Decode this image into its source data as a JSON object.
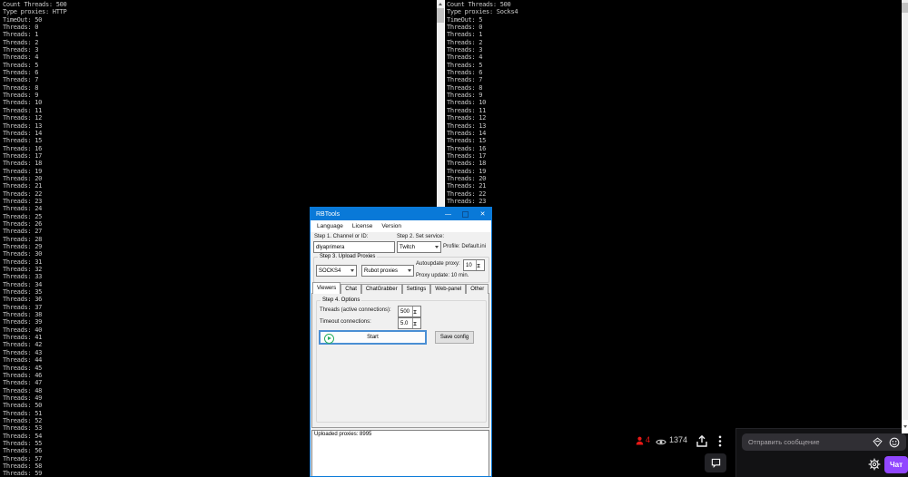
{
  "colors": {
    "accent_blue": "#0979d8",
    "twitch_purple": "#9147ff",
    "live_red": "#e91916",
    "start_green": "#27ae60"
  },
  "left_console": {
    "lines": [
      "Count Threads: 500",
      "Type proxies: HTTP",
      "TimeOut: 50",
      "Threads: 0",
      "Threads: 1",
      "Threads: 2",
      "Threads: 3",
      "Threads: 4",
      "Threads: 5",
      "Threads: 6",
      "Threads: 7",
      "Threads: 8",
      "Threads: 9",
      "Threads: 10",
      "Threads: 11",
      "Threads: 12",
      "Threads: 13",
      "Threads: 14",
      "Threads: 15",
      "Threads: 16",
      "Threads: 17",
      "Threads: 18",
      "Threads: 19",
      "Threads: 20",
      "Threads: 21",
      "Threads: 22",
      "Threads: 23",
      "Threads: 24",
      "Threads: 25",
      "Threads: 26",
      "Threads: 27",
      "Threads: 28",
      "Threads: 29",
      "Threads: 30",
      "Threads: 31",
      "Threads: 32",
      "Threads: 33",
      "Threads: 34",
      "Threads: 35",
      "Threads: 36",
      "Threads: 37",
      "Threads: 38",
      "Threads: 39",
      "Threads: 40",
      "Threads: 41",
      "Threads: 42",
      "Threads: 43",
      "Threads: 44",
      "Threads: 45",
      "Threads: 46",
      "Threads: 47",
      "Threads: 48",
      "Threads: 49",
      "Threads: 50",
      "Threads: 51",
      "Threads: 52",
      "Threads: 53",
      "Threads: 54",
      "Threads: 55",
      "Threads: 56",
      "Threads: 57",
      "Threads: 58",
      "Threads: 59"
    ]
  },
  "right_console": {
    "lines": [
      "Count Threads: 500",
      "Type proxies: Socks4",
      "TimeOut: 5",
      "Threads: 0",
      "Threads: 1",
      "Threads: 2",
      "Threads: 3",
      "Threads: 4",
      "Threads: 5",
      "Threads: 6",
      "Threads: 7",
      "Threads: 8",
      "Threads: 9",
      "Threads: 10",
      "Threads: 11",
      "Threads: 12",
      "Threads: 13",
      "Threads: 14",
      "Threads: 15",
      "Threads: 16",
      "Threads: 17",
      "Threads: 18",
      "Threads: 19",
      "Threads: 20",
      "Threads: 21",
      "Threads: 22",
      "Threads: 23"
    ]
  },
  "rbtools": {
    "title": "RBTools",
    "minimize_glyph": "—",
    "close_glyph": "✕",
    "menu": [
      "Language",
      "License",
      "Version"
    ],
    "step1_label": "Step 1. Channel or ID:",
    "channel_value": "dlyaprimera",
    "step2_label": "Step 2. Set service:",
    "service_value": "Twitch",
    "profile_label": "Profile: Default.ini",
    "step3_group": "Step 3. Upload Proxies",
    "proxy_type_value": "SOCKS4",
    "proxy_source_value": "Rubot proxies",
    "autoupdate_label": "Autoupdate proxy:",
    "autoupdate_value": "10",
    "proxy_update_label": "Proxy update: 10 min.",
    "tabs": [
      "Viewers",
      "Chat",
      "ChatGrabber",
      "Settings",
      "Web-panel",
      "Other"
    ],
    "selected_tab": "Viewers",
    "step4_group": "Step 4. Options",
    "threads_label": "Threads (active connections):",
    "threads_value": "500",
    "timeout_label": "Timeout connections:",
    "timeout_value": "5.0",
    "start_button": "Start",
    "save_button": "Save config",
    "log_text": "Uploaded proxies: 8995"
  },
  "player": {
    "session_viewers": "4",
    "viewer_count": "1374"
  },
  "chat": {
    "placeholder": "Отправить сообщение",
    "send_button": "Чат"
  }
}
